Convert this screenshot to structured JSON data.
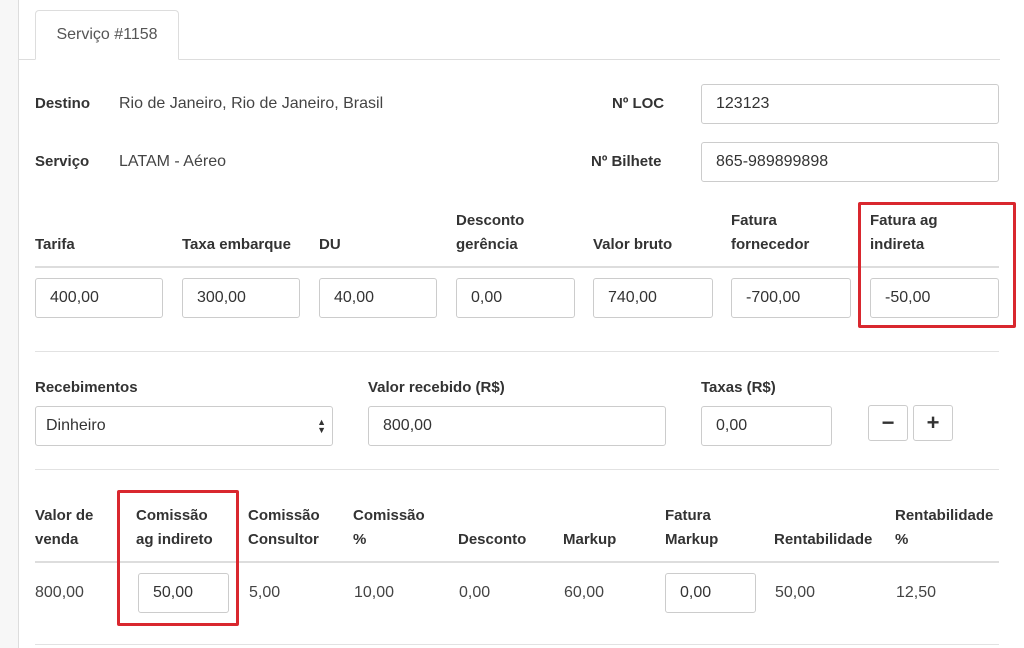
{
  "tab": {
    "label": "Serviço #1158"
  },
  "info": {
    "destino_label": "Destino",
    "destino_value": "Rio de Janeiro, Rio de Janeiro, Brasil",
    "servico_label": "Serviço",
    "servico_value": "LATAM - Aéreo",
    "loc_label": "Nº LOC",
    "loc_value": "123123",
    "bilhete_label": "Nº Bilhete",
    "bilhete_value": "865-989899898"
  },
  "tarifas": {
    "headers": {
      "tarifa": "Tarifa",
      "taxa_embarque": "Taxa embarque",
      "du": "DU",
      "desconto_1": "Desconto",
      "desconto_2": "gerência",
      "valor_bruto": "Valor bruto",
      "fatura_fornecedor_1": "Fatura",
      "fatura_fornecedor_2": "fornecedor",
      "fatura_indireta_1": "Fatura ag",
      "fatura_indireta_2": "indireta"
    },
    "values": {
      "tarifa": "400,00",
      "taxa_embarque": "300,00",
      "du": "40,00",
      "desconto_gerencia": "0,00",
      "valor_bruto": "740,00",
      "fatura_fornecedor": "-700,00",
      "fatura_indireta": "-50,00"
    }
  },
  "recebimentos": {
    "recebimentos_label": "Recebimentos",
    "recebimentos_value": "Dinheiro",
    "valor_recebido_label": "Valor recebido (R$)",
    "valor_recebido_value": "800,00",
    "taxas_label": "Taxas (R$)",
    "taxas_value": "0,00",
    "minus_label": "−",
    "plus_label": "+"
  },
  "resumo": {
    "headers": {
      "valor_venda_1": "Valor de",
      "valor_venda_2": "venda",
      "comissao_indireto_1": "Comissão",
      "comissao_indireto_2": "ag indireto",
      "comissao_consultor_1": "Comissão",
      "comissao_consultor_2": "Consultor",
      "comissao_pct_1": "Comissão",
      "comissao_pct_2": "%",
      "desconto": "Desconto",
      "markup": "Markup",
      "fatura_markup_1": "Fatura",
      "fatura_markup_2": "Markup",
      "rentabilidade": "Rentabilidade",
      "rentabilidade_pct_1": "Rentabilidade",
      "rentabilidade_pct_2": "%"
    },
    "values": {
      "valor_venda": "800,00",
      "comissao_indireto": "50,00",
      "comissao_consultor": "5,00",
      "comissao_pct": "10,00",
      "desconto": "0,00",
      "markup": "60,00",
      "fatura_markup": "0,00",
      "rentabilidade": "50,00",
      "rentabilidade_pct": "12,50"
    }
  },
  "colors": {
    "highlight": "#d9272e"
  }
}
